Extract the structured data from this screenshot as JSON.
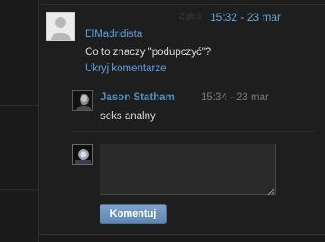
{
  "comment": {
    "author": "ElMadridista",
    "report_label": "Zgłoś",
    "timestamp": "15:32 - 23 mar",
    "text": "Co to znaczy \"podupczyć\"?",
    "hide_label": "Ukryj komentarze"
  },
  "reply": {
    "author": "Jason Statham",
    "timestamp": "15:34 - 23 mar",
    "text": "seks analny"
  },
  "form": {
    "textarea_value": "",
    "submit_label": "Komentuj"
  },
  "icons": {
    "default_avatar": "default-avatar-icon",
    "resize": "resize-grip-icon"
  },
  "colors": {
    "link": "#5e9fe0",
    "timestamp": "#63a7d6",
    "button": "#6f94bb",
    "background": "#1e1e1e"
  }
}
